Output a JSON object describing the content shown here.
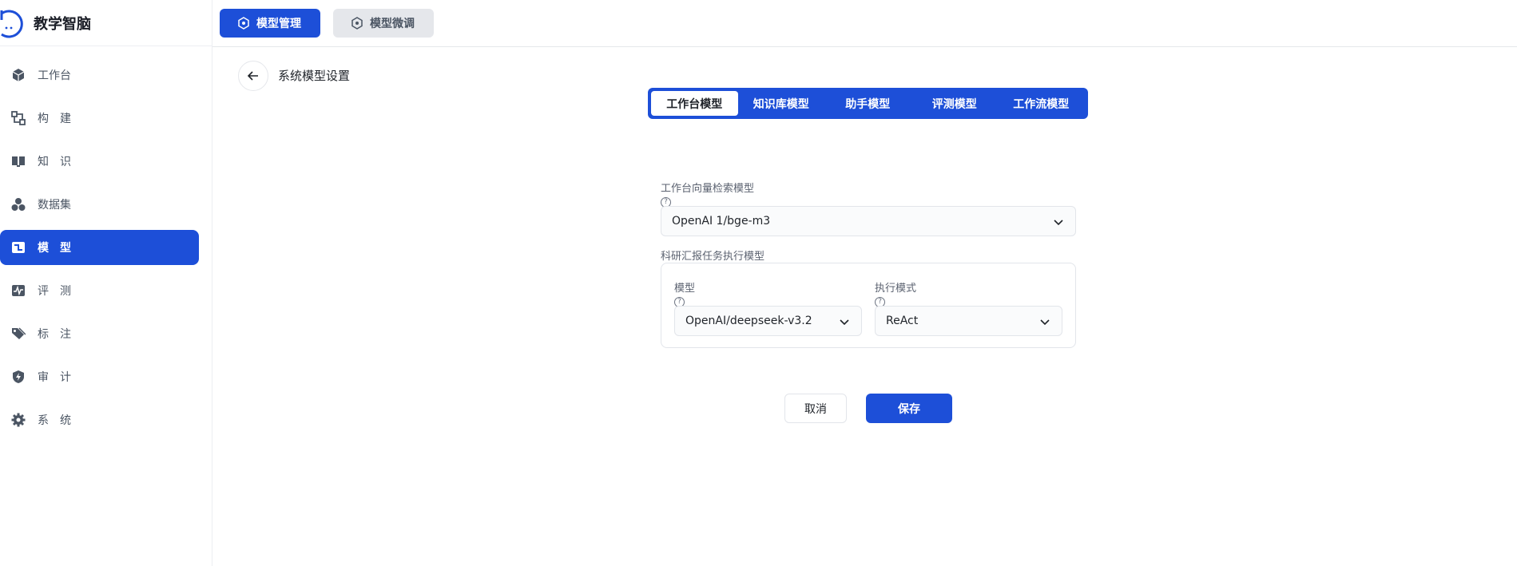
{
  "app": {
    "title": "教学智脑"
  },
  "sidebar": {
    "items": [
      {
        "label": "工作台",
        "icon": "cube-icon",
        "active": false
      },
      {
        "label": "构建",
        "icon": "build-flow-icon",
        "active": false
      },
      {
        "label": "知识",
        "icon": "book-icon",
        "active": false
      },
      {
        "label": "数据集",
        "icon": "dataset-circles-icon",
        "active": false
      },
      {
        "label": "模型",
        "icon": "model-icon",
        "active": true
      },
      {
        "label": "评测",
        "icon": "pulse-chart-icon",
        "active": false
      },
      {
        "label": "标注",
        "icon": "tag-icon",
        "active": false
      },
      {
        "label": "审计",
        "icon": "shield-bolt-icon",
        "active": false
      },
      {
        "label": "系统",
        "icon": "gear-icon",
        "active": false
      }
    ]
  },
  "topbar": {
    "tabs": [
      {
        "label": "模型管理",
        "active": true
      },
      {
        "label": "模型微调",
        "active": false
      }
    ]
  },
  "page": {
    "title": "系统模型设置"
  },
  "model_tabs": {
    "items": [
      {
        "label": "工作台模型",
        "active": true
      },
      {
        "label": "知识库模型",
        "active": false
      },
      {
        "label": "助手模型",
        "active": false
      },
      {
        "label": "评测模型",
        "active": false
      },
      {
        "label": "工作流模型",
        "active": false
      }
    ]
  },
  "form": {
    "vector_model": {
      "label": "工作台向量检索模型",
      "help": "?",
      "value": "OpenAI 1/bge-m3"
    },
    "report_task": {
      "label": "科研汇报任务执行模型",
      "model": {
        "label": "模型",
        "help": "?",
        "value": "OpenAI/deepseek-v3.2"
      },
      "mode": {
        "label": "执行模式",
        "help": "?",
        "value": "ReAct"
      }
    }
  },
  "actions": {
    "cancel": "取消",
    "save": "保存"
  },
  "colors": {
    "accent": "#1d4fd8",
    "border": "#e2e5ea",
    "muted_text": "#5b6270"
  }
}
